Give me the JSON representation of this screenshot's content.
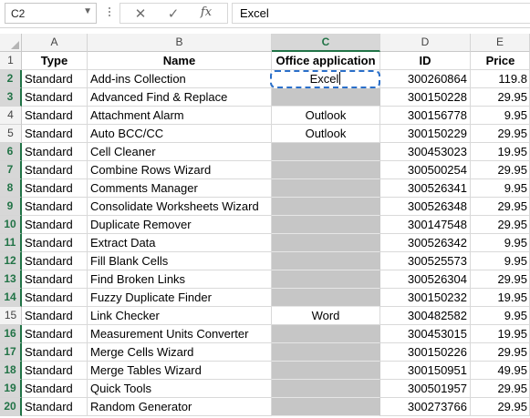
{
  "name_box": {
    "value": "C2",
    "dropdown_icon": "chevron-down-icon"
  },
  "formula_bar": {
    "cancel_icon": "close-icon",
    "enter_icon": "checkmark-icon",
    "function_icon": "fx-icon",
    "function_label": "fx",
    "value": "Excel"
  },
  "columns": [
    "A",
    "B",
    "C",
    "D",
    "E"
  ],
  "selected_column": "C",
  "selection_color": "#217346",
  "highlight_fill": "#c6c6c6",
  "header_row": {
    "row": "1",
    "cells": [
      "Type",
      "Name",
      "Office application",
      "ID",
      "Price"
    ]
  },
  "rows": [
    {
      "row": "2",
      "type": "Standard",
      "name": "Add-ins Collection",
      "app": "Excel",
      "id": "300260864",
      "price": "119.8",
      "selected": true,
      "gray": false
    },
    {
      "row": "3",
      "type": "Standard",
      "name": "Advanced Find & Replace",
      "app": "",
      "id": "300150228",
      "price": "29.95",
      "selected": true,
      "gray": true
    },
    {
      "row": "4",
      "type": "Standard",
      "name": "Attachment Alarm",
      "app": "Outlook",
      "id": "300156778",
      "price": "9.95",
      "selected": false,
      "gray": false
    },
    {
      "row": "5",
      "type": "Standard",
      "name": "Auto BCC/CC",
      "app": "Outlook",
      "id": "300150229",
      "price": "29.95",
      "selected": false,
      "gray": false
    },
    {
      "row": "6",
      "type": "Standard",
      "name": "Cell Cleaner",
      "app": "",
      "id": "300453023",
      "price": "19.95",
      "selected": true,
      "gray": true
    },
    {
      "row": "7",
      "type": "Standard",
      "name": "Combine Rows Wizard",
      "app": "",
      "id": "300500254",
      "price": "29.95",
      "selected": true,
      "gray": true
    },
    {
      "row": "8",
      "type": "Standard",
      "name": "Comments Manager",
      "app": "",
      "id": "300526341",
      "price": "9.95",
      "selected": true,
      "gray": true
    },
    {
      "row": "9",
      "type": "Standard",
      "name": "Consolidate Worksheets Wizard",
      "app": "",
      "id": "300526348",
      "price": "29.95",
      "selected": true,
      "gray": true
    },
    {
      "row": "10",
      "type": "Standard",
      "name": "Duplicate Remover",
      "app": "",
      "id": "300147548",
      "price": "29.95",
      "selected": true,
      "gray": true
    },
    {
      "row": "11",
      "type": "Standard",
      "name": "Extract Data",
      "app": "",
      "id": "300526342",
      "price": "9.95",
      "selected": true,
      "gray": true
    },
    {
      "row": "12",
      "type": "Standard",
      "name": "Fill Blank Cells",
      "app": "",
      "id": "300525573",
      "price": "9.95",
      "selected": true,
      "gray": true
    },
    {
      "row": "13",
      "type": "Standard",
      "name": "Find Broken Links",
      "app": "",
      "id": "300526304",
      "price": "29.95",
      "selected": true,
      "gray": true
    },
    {
      "row": "14",
      "type": "Standard",
      "name": "Fuzzy Duplicate Finder",
      "app": "",
      "id": "300150232",
      "price": "19.95",
      "selected": true,
      "gray": true
    },
    {
      "row": "15",
      "type": "Standard",
      "name": "Link Checker",
      "app": "Word",
      "id": "300482582",
      "price": "9.95",
      "selected": false,
      "gray": false
    },
    {
      "row": "16",
      "type": "Standard",
      "name": "Measurement Units Converter",
      "app": "",
      "id": "300453015",
      "price": "19.95",
      "selected": true,
      "gray": true
    },
    {
      "row": "17",
      "type": "Standard",
      "name": "Merge Cells Wizard",
      "app": "",
      "id": "300150226",
      "price": "29.95",
      "selected": true,
      "gray": true
    },
    {
      "row": "18",
      "type": "Standard",
      "name": "Merge Tables Wizard",
      "app": "",
      "id": "300150951",
      "price": "49.95",
      "selected": true,
      "gray": true
    },
    {
      "row": "19",
      "type": "Standard",
      "name": "Quick Tools",
      "app": "",
      "id": "300501957",
      "price": "29.95",
      "selected": true,
      "gray": true
    },
    {
      "row": "20",
      "type": "Standard",
      "name": "Random Generator",
      "app": "",
      "id": "300273766",
      "price": "29.95",
      "selected": true,
      "gray": true
    }
  ]
}
